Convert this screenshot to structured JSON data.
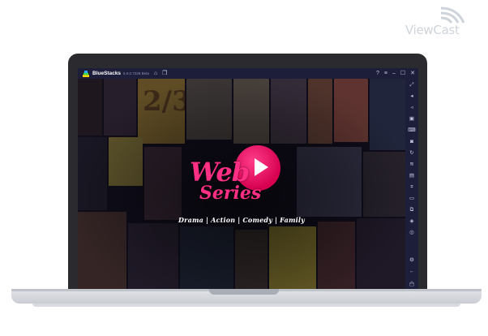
{
  "watermark": {
    "text": "ViewCast"
  },
  "titlebar": {
    "app_name": "BlueStacks",
    "version": "5.0.0.7228 Beta",
    "left_icons": [
      "home-icon",
      "multi-instance-icon"
    ],
    "right_icons": [
      "help-icon",
      "menu-icon",
      "minimize-icon",
      "maximize-icon",
      "close-icon"
    ],
    "glyphs": {
      "home": "⌂",
      "multi": "❐",
      "help": "?",
      "menu": "≡",
      "minimize": "–",
      "maximize": "☐",
      "close": "✕"
    }
  },
  "app": {
    "logo_web": "Web",
    "logo_series": "Series",
    "tagline": "Drama | Action | Comedy | Family"
  },
  "sidebar": {
    "icons": [
      {
        "name": "fullscreen-icon",
        "glyph": "⤢"
      },
      {
        "name": "volume-up-icon",
        "glyph": "◂"
      },
      {
        "name": "volume-down-icon",
        "glyph": "◃"
      },
      {
        "name": "media-icon",
        "glyph": "▣"
      },
      {
        "name": "keyboard-icon",
        "glyph": "⌨"
      },
      {
        "name": "screenshot-icon",
        "glyph": "◙"
      },
      {
        "name": "rotate-icon",
        "glyph": "↻"
      },
      {
        "name": "shake-icon",
        "glyph": "≋"
      },
      {
        "name": "apk-icon",
        "glyph": "▤"
      },
      {
        "name": "scan-icon",
        "glyph": "⌗"
      },
      {
        "name": "folder-icon",
        "glyph": "▭"
      },
      {
        "name": "copy-icon",
        "glyph": "⧉"
      },
      {
        "name": "eco-icon",
        "glyph": "◈"
      },
      {
        "name": "macro-icon",
        "glyph": "◎"
      },
      {
        "name": "settings-icon",
        "glyph": "⚙"
      },
      {
        "name": "back-icon",
        "glyph": "←"
      },
      {
        "name": "home-nav-icon",
        "glyph": "⌂"
      },
      {
        "name": "recents-icon",
        "glyph": "▢"
      }
    ]
  },
  "colors": {
    "accent": "#ff2f84",
    "titlebar": "#1c1e3a",
    "bezel": "#2b2b2f"
  }
}
